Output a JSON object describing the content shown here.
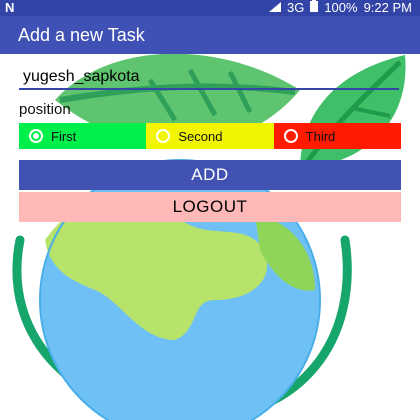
{
  "status_bar": {
    "left_icon": "notification-n-icon",
    "network": "3G",
    "battery": "100%",
    "time": "9:22 PM"
  },
  "app_bar": {
    "title": "Add a new Task"
  },
  "form": {
    "name_value": "yugesh_sapkota",
    "position_label": "position",
    "radios": [
      {
        "label": "First",
        "color": "#00ef4a",
        "checked": true
      },
      {
        "label": "Second",
        "color": "#f1f501",
        "checked": false
      },
      {
        "label": "Third",
        "color": "#ff1a00",
        "checked": false
      }
    ],
    "add_label": "ADD",
    "logout_label": "LOGOUT"
  },
  "colors": {
    "status_bar": "#3344a8",
    "app_bar": "#4051b5",
    "add_button": "#4152b3",
    "logout_button": "#ffb8b8"
  }
}
